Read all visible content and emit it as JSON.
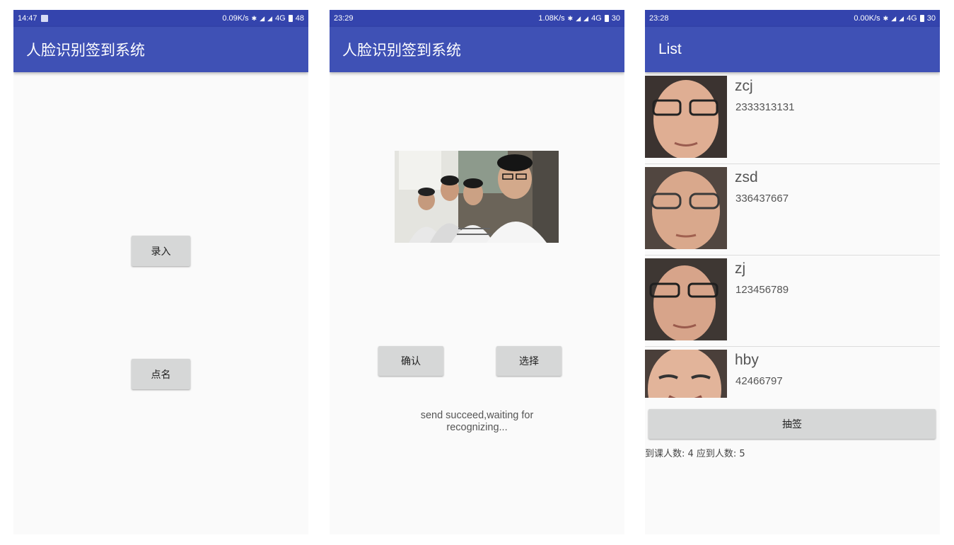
{
  "screens": [
    {
      "status": {
        "time": "14:47",
        "speed": "0.09K/s",
        "network": "4G",
        "battery": "48"
      },
      "appbar_title": "人脸识别签到系统",
      "buttons": {
        "enroll": "录入",
        "rollcall": "点名"
      }
    },
    {
      "status": {
        "time": "23:29",
        "speed": "1.08K/s",
        "network": "4G",
        "battery": "30"
      },
      "appbar_title": "人脸识别签到系统",
      "buttons": {
        "confirm": "确认",
        "select": "选择"
      },
      "message": "send succeed,waiting for recognizing..."
    },
    {
      "status": {
        "time": "23:28",
        "speed": "0.00K/s",
        "network": "4G",
        "battery": "30"
      },
      "appbar_title": "List",
      "students": [
        {
          "name": "zcj",
          "id": "2333313131"
        },
        {
          "name": "zsd",
          "id": "336437667"
        },
        {
          "name": "zj",
          "id": "123456789"
        },
        {
          "name": "hby",
          "id": "42466797"
        }
      ],
      "draw_button": "抽签",
      "attendance": "到课人数: 4  应到人数: 5"
    }
  ],
  "colors": {
    "statusbar": "#3444ad",
    "appbar": "#3f51b5",
    "button": "#d6d7d7",
    "background": "#fafafa"
  }
}
